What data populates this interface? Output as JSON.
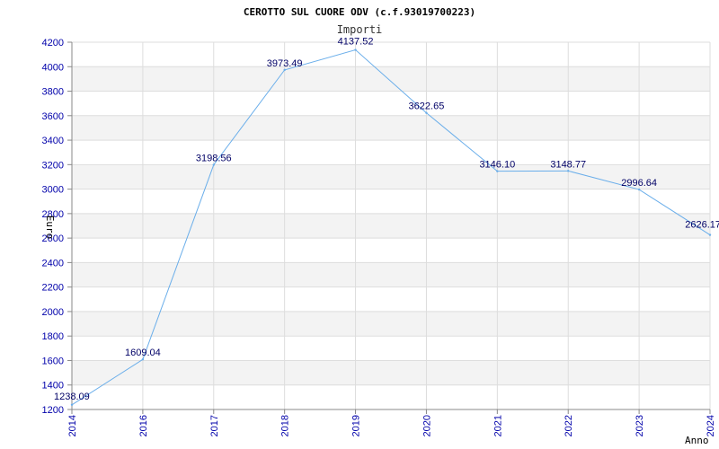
{
  "chart_data": {
    "type": "line",
    "title": "CEROTTO SUL CUORE ODV (c.f.93019700223)",
    "subtitle": "Importi",
    "xlabel": "Anno",
    "ylabel": "Euro",
    "categories": [
      "2014",
      "2016",
      "2017",
      "2018",
      "2019",
      "2020",
      "2021",
      "2022",
      "2023",
      "2024"
    ],
    "values": [
      1238.09,
      1609.04,
      3198.56,
      3973.49,
      4137.52,
      3622.65,
      3146.1,
      3148.77,
      2996.64,
      2626.17
    ],
    "value_labels": [
      "1238.09",
      "1609.04",
      "3198.56",
      "3973.49",
      "4137.52",
      "3622.65",
      "3146.10",
      "3148.77",
      "2996.64",
      "2626.17"
    ],
    "ylim": [
      1200,
      4200
    ],
    "yticks": [
      1200,
      1400,
      1600,
      1800,
      2000,
      2200,
      2400,
      2600,
      2800,
      3000,
      3200,
      3400,
      3600,
      3800,
      4000,
      4200
    ],
    "grid": true,
    "line_color": "#6aaeea",
    "band_color": "#f3f3f3",
    "tick_color": "#0000aa"
  }
}
